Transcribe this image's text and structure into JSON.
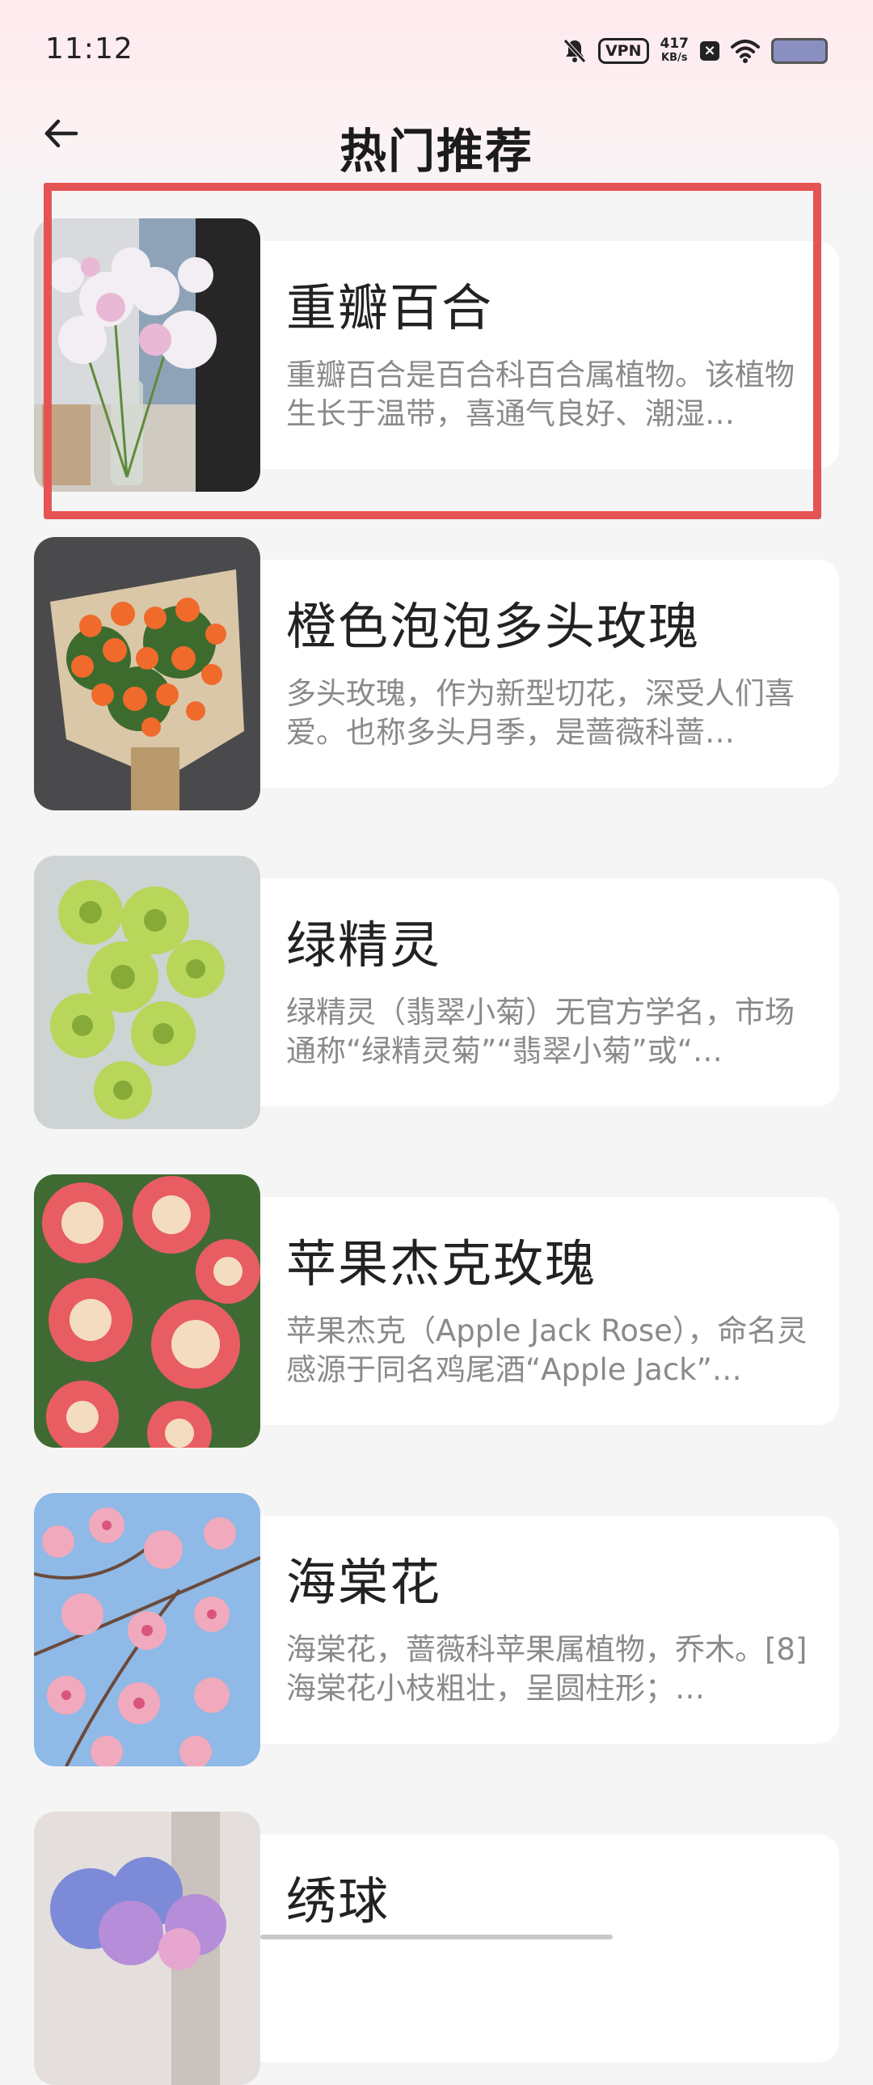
{
  "status_bar": {
    "time": "11:12",
    "vpn": "VPN",
    "speed_value": "417",
    "speed_unit": "KB/s",
    "icons": [
      "mute-bell-icon",
      "vpn-icon",
      "network-speed",
      "close-box-icon",
      "wifi-icon",
      "battery-icon"
    ]
  },
  "header": {
    "title": "热门推荐",
    "back_icon": "arrow-left-icon"
  },
  "highlight_color": "#e55454",
  "items": [
    {
      "title": "重瓣百合",
      "desc": "重瓣百合是百合科百合属植物。该植物生长于温带，喜通气良好、潮湿…",
      "image": "lily-bouquet-photo"
    },
    {
      "title": "橙色泡泡多头玫瑰",
      "desc": "多头玫瑰，作为新型切花，深受人们喜爱。也称多头月季，是蔷薇科蔷…",
      "image": "orange-spray-rose-bouquet-photo"
    },
    {
      "title": "绿精灵",
      "desc": "绿精灵（翡翠小菊）无官方学名，市场通称“绿精灵菊”“翡翠小菊”或“…",
      "image": "green-chrysanthemum-photo"
    },
    {
      "title": "苹果杰克玫瑰",
      "desc": "苹果杰克（Apple Jack Rose），命名灵感源于同名鸡尾酒“Apple Jack”…",
      "image": "apple-jack-rose-photo"
    },
    {
      "title": "海棠花",
      "desc": "海棠花，蔷薇科苹果属植物，乔木。[8]海棠花小枝粗壮，呈圆柱形；…",
      "image": "crabapple-blossom-photo"
    },
    {
      "title": "绣球",
      "desc": "",
      "image": "hydrangea-photo"
    }
  ]
}
